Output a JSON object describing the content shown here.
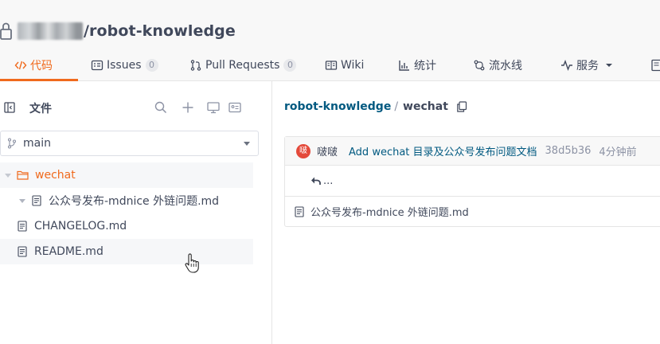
{
  "header": {
    "owner": "不得止事",
    "repo_path": "/robot-knowledge"
  },
  "tabs": [
    {
      "label": "代码",
      "icon": "code-icon",
      "active": true
    },
    {
      "label": "Issues",
      "badge": "0",
      "icon": "issues-icon"
    },
    {
      "label": "Pull Requests",
      "badge": "0",
      "icon": "pull-request-icon"
    },
    {
      "label": "Wiki",
      "icon": "wiki-icon"
    },
    {
      "label": "统计",
      "icon": "stats-icon"
    },
    {
      "label": "流水线",
      "icon": "pipeline-icon"
    },
    {
      "label": "服务",
      "icon": "service-icon"
    }
  ],
  "sidebar": {
    "title": "文件",
    "branch": "main",
    "tree": [
      {
        "label": "wechat",
        "type": "folder",
        "expanded": true,
        "active": true
      },
      {
        "label": "公众号发布-mdnice 外链问题.md",
        "type": "file",
        "level": 1
      },
      {
        "label": "CHANGELOG.md",
        "type": "file"
      },
      {
        "label": "README.md",
        "type": "file",
        "hover": true
      }
    ]
  },
  "main": {
    "breadcrumb_repo": "robot-knowledge",
    "breadcrumb_sep": "/",
    "breadcrumb_current": "wechat",
    "commit": {
      "avatar_text": "啵",
      "author": "啵啵",
      "message": "Add wechat 目录及公众号发布问题文档",
      "sha": "38d5b36",
      "time": "4分钟前"
    },
    "up_label": "...",
    "files": [
      {
        "label": "公众号发布-mdnice 外链问题.md"
      }
    ]
  },
  "colors": {
    "accent": "#f06a1d",
    "link": "#005980",
    "avatar": "#e4493a"
  }
}
